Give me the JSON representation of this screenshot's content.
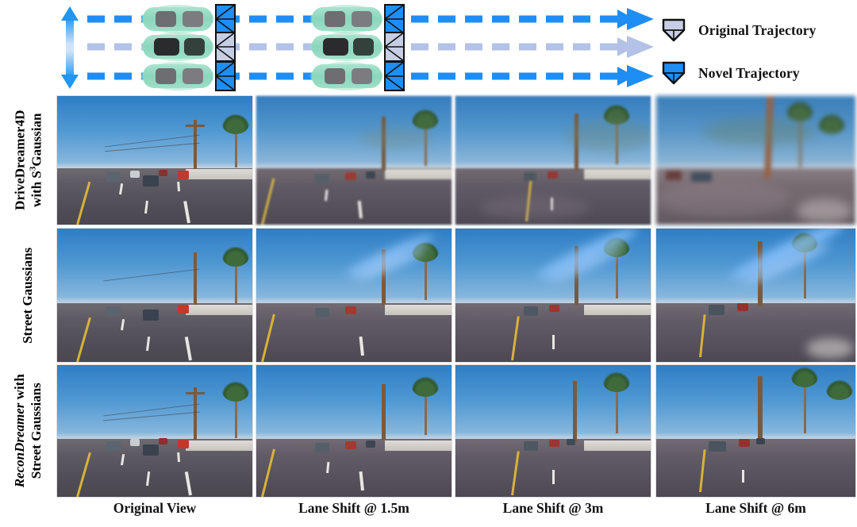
{
  "diagram": {
    "vertical_arrow": {
      "name": "lane-shift-range-arrow",
      "color": "#2196F3"
    },
    "trajectories": [
      {
        "id": "novel-top",
        "type": "Novel Trajectory",
        "color": "#1E8EF5",
        "style": "dashed",
        "camera": "novel-camera-frustum"
      },
      {
        "id": "original-mid",
        "type": "Original Trajectory",
        "color": "#B3C2E6",
        "style": "dashed",
        "camera": "original-camera-frustum"
      },
      {
        "id": "novel-bottom",
        "type": "Novel Trajectory",
        "color": "#1E8EF5",
        "style": "dashed",
        "camera": "novel-camera-frustum"
      }
    ],
    "car_color": "#8FD9C0",
    "car_groups": 2,
    "cars_per_group": 3
  },
  "legend": {
    "items": [
      {
        "label": "Original Trajectory",
        "color": "#B3C2E6",
        "icon": "camera-frustum-icon"
      },
      {
        "label": "Novel Trajectory",
        "color": "#1E8EF5",
        "icon": "camera-frustum-icon"
      }
    ]
  },
  "rows": [
    {
      "id": "row-drivedreamer4d",
      "lines": [
        "DriveDreamer4D",
        "with S3Gaussian"
      ],
      "line1": "DriveDreamer4D",
      "line2_pre": "with S",
      "line2_sup": "3",
      "line2_post": "Gaussian",
      "italic_prefix": "",
      "quality": "degraded"
    },
    {
      "id": "row-street-gaussians",
      "lines": [
        "Street Gaussians"
      ],
      "line1": "Street Gaussians",
      "quality": "artifacts"
    },
    {
      "id": "row-recondreamer",
      "lines": [
        "ReconDreamer with",
        "Street Gaussians"
      ],
      "line1_ital": "ReconDreamer",
      "line1_post": " with",
      "line2": "Street Gaussians",
      "quality": "clean"
    }
  ],
  "columns": [
    {
      "id": "col-original-view",
      "label": "Original View",
      "shift_m": 0
    },
    {
      "id": "col-lane-shift-1-5m",
      "label": "Lane Shift @ 1.5m",
      "shift_m": 1.5
    },
    {
      "id": "col-lane-shift-3m",
      "label": "Lane Shift @ 3m",
      "shift_m": 3
    },
    {
      "id": "col-lane-shift-6m",
      "label": "Lane Shift @ 6m",
      "shift_m": 6
    }
  ],
  "scene": {
    "description": "Urban arterial road, clear blue sky, palm trees, utility poles, multiple vehicles ahead",
    "sky_color": "#3F8AC9",
    "road_color": "#57535E",
    "lane_marking_color": "#E8E6E2",
    "center_line_color": "#D8B23A"
  }
}
